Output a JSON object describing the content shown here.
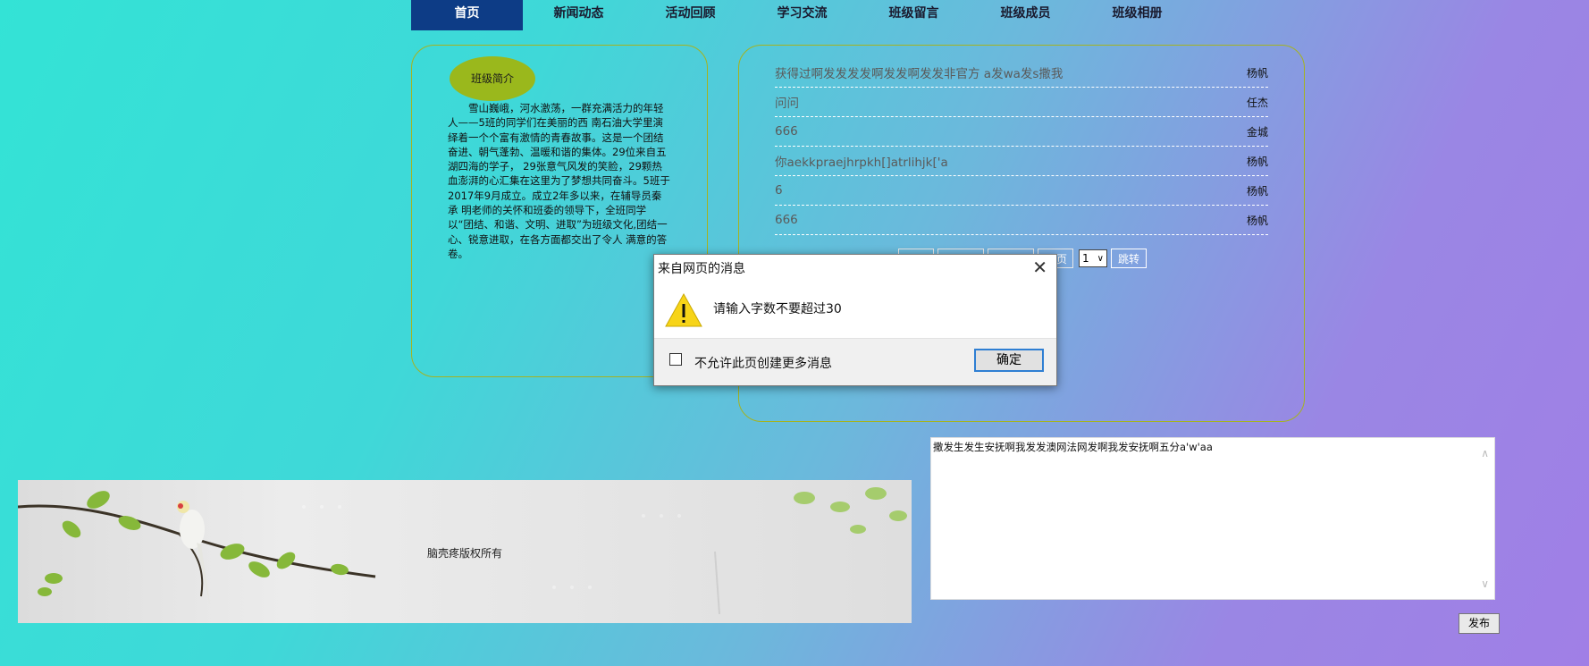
{
  "nav": {
    "items": [
      "首页",
      "新闻动态",
      "活动回顾",
      "学习交流",
      "班级留言",
      "班级成员",
      "班级相册"
    ]
  },
  "intro": {
    "badge": "班级简介",
    "text": "雪山巍峨，河水激荡，一群充满活力的年轻人——5班的同学们在美丽的西 南石油大学里演绎着一个个富有激情的青春故事。这是一个团结奋进、朝气蓬勃、温暖和谐的集体。29位来自五湖四海的学子， 29张意气风发的笑脸，29颗热血澎湃的心汇集在这里为了梦想共同奋斗。5班于2017年9月成立。成立2年多以来，在辅导员秦承 明老师的关怀和班委的领导下，全班同学以“团结、和谐、文明、进取”为班级文化,团结一心、锐意进取，在各方面都交出了令人 满意的答卷。"
  },
  "messages": [
    {
      "text": "获得过啊发发发发啊发发啊发发非官方 a发wa发s撒我",
      "author": "杨帆"
    },
    {
      "text": "问问",
      "author": "任杰"
    },
    {
      "text": "666",
      "author": "金城"
    },
    {
      "text": "你aekkpraejhrpkh[]atrlihjk['a",
      "author": "杨帆"
    },
    {
      "text": "6",
      "author": "杨帆"
    },
    {
      "text": "666",
      "author": "杨帆"
    }
  ],
  "pager": {
    "last_fragment": "页",
    "page_value": "1",
    "jump_label": "跳转"
  },
  "banner": {
    "copyright": "脑壳疼版权所有"
  },
  "reply": {
    "text": "撒发生发生安抚啊我发发澳网法网发啊我发安抚啊五分a'w'aa",
    "publish_label": "发布"
  },
  "dialog": {
    "title": "来自网页的消息",
    "message": "请输入字数不要超过30",
    "checkbox_label": "不允许此页创建更多消息",
    "ok_label": "确定"
  }
}
